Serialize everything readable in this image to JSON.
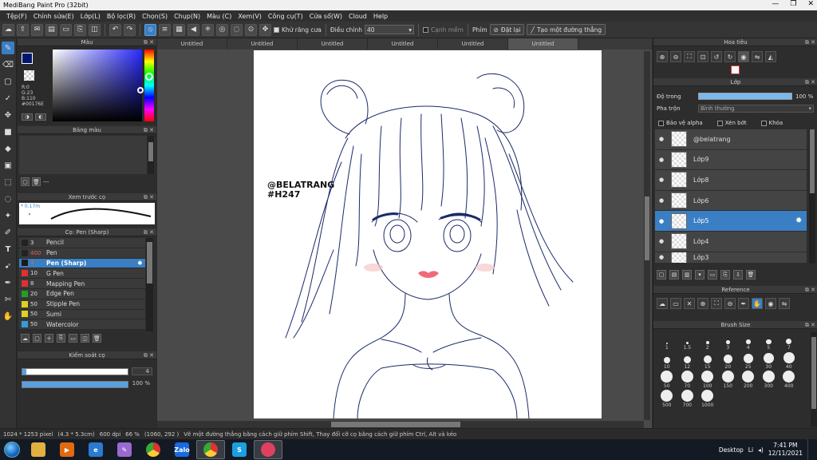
{
  "window": {
    "title": "MediBang Paint Pro (32bit)"
  },
  "menu": [
    "Tệp(F)",
    "Chỉnh sửa(E)",
    "Lớp(L)",
    "Bộ lọc(R)",
    "Chọn(S)",
    "Chụp(N)",
    "Màu (C)",
    "Xem(V)",
    "Công cụ(T)",
    "Cửa sổ(W)",
    "Cloud",
    "Help"
  ],
  "toolbar": {
    "antialias_label": "Khử răng cưa",
    "adjust_label": "Điều chỉnh",
    "adjust_value": "40",
    "soft_edge_label": "Cạnh mềm",
    "key_label": "Phím",
    "reset_label": "Đặt lại",
    "straight_line_label": "Tạo một đường thẳng"
  },
  "panels": {
    "color": "Màu",
    "palette": "Bảng màu",
    "preview": "Xem trước cọ",
    "brush": "Cọ: Pen (Sharp)",
    "control": "Kiểm soát cọ",
    "navigator": "Hoa tiêu",
    "layer": "Lớp",
    "reference": "Reference",
    "brush_size": "Brush Size"
  },
  "color": {
    "fg_hex": "#00176E",
    "rgb_r": "R:0",
    "rgb_g": "G:23",
    "rgb_b": "B:110",
    "rgb_hex": "#00176E"
  },
  "palette_text": "---",
  "preview_size": "0.17m",
  "brushes": [
    {
      "size": "3",
      "name": "Pencil",
      "color": "#222222"
    },
    {
      "size": "400",
      "name": "Pen",
      "color": "#222222"
    },
    {
      "size": "4",
      "name": "Pen (Sharp)",
      "color": "#1a1a1a",
      "selected": true
    },
    {
      "size": "10",
      "name": "G Pen",
      "color": "#e03030"
    },
    {
      "size": "8",
      "name": "Mapping Pen",
      "color": "#e03030"
    },
    {
      "size": "20",
      "name": "Edge Pen",
      "color": "#22a020"
    },
    {
      "size": "50",
      "name": "Stipple Pen",
      "color": "#e0d020"
    },
    {
      "size": "50",
      "name": "Sumi",
      "color": "#e0d020"
    },
    {
      "size": "50",
      "name": "Watercolor",
      "color": "#3a9ad8"
    }
  ],
  "brush_control": {
    "size_value": "4",
    "size_fraction": 0.04,
    "opacity_value": "100 %",
    "opacity_fraction": 1.0
  },
  "doc_tabs": [
    "Untitled",
    "Untitled",
    "Untitled",
    "Untitled",
    "Untitled",
    "Untitled"
  ],
  "watermark": {
    "line1": "@BELATRANG",
    "line2": "#H247"
  },
  "layer": {
    "opacity_label": "Độ trong",
    "opacity_value": "100 %",
    "blend_label": "Pha trộn",
    "blend_value": "Bình thường",
    "protect_alpha": "Bảo vệ alpha",
    "clipping": "Xén bớt",
    "lock": "Khóa",
    "layers": [
      {
        "name": "@belatrang",
        "selected": false
      },
      {
        "name": "Lớp9",
        "selected": false
      },
      {
        "name": "Lớp8",
        "selected": false
      },
      {
        "name": "Lớp6",
        "selected": false
      },
      {
        "name": "Lớp5",
        "selected": true
      },
      {
        "name": "Lớp4",
        "selected": false
      },
      {
        "name": "Lớp3",
        "selected": false
      }
    ]
  },
  "brush_sizes": [
    "1",
    "1.5",
    "2",
    "3",
    "4",
    "5",
    "7",
    "10",
    "12",
    "15",
    "20",
    "25",
    "30",
    "40",
    "50",
    "70",
    "100",
    "150",
    "200",
    "300",
    "400",
    "500",
    "700",
    "1000"
  ],
  "status": {
    "dimensions": "1024 * 1253 pixel",
    "physical": "(4.3 * 5.3cm)",
    "dpi": "600 dpi",
    "zoom": "66 %",
    "coords": "(1060, 292 )",
    "hint": "Vẽ một đường thẳng bằng cách giữ phím Shift, Thay đổi cỡ cọ bằng cách giữ phím Ctrl, Alt và kéo"
  },
  "taskbar": {
    "desktop_label": "Desktop",
    "lang": "Li",
    "time": "7:41 PM",
    "date": "12/11/2021",
    "apps": [
      {
        "name": "explorer",
        "label": "",
        "color": "#e0b040"
      },
      {
        "name": "media",
        "label": "▶",
        "color": "#e06a10"
      },
      {
        "name": "ie",
        "label": "e",
        "color": "#2a7ad0"
      },
      {
        "name": "paint",
        "label": "✎",
        "color": "#9a6ad0"
      },
      {
        "name": "chrome",
        "label": "",
        "color": "#d04030"
      },
      {
        "name": "zalo",
        "label": "Zalo",
        "color": "#1a6ae0"
      },
      {
        "name": "chrome2",
        "label": "",
        "color": "#d04030"
      },
      {
        "name": "skype",
        "label": "S",
        "color": "#1aa0e0"
      },
      {
        "name": "medibang",
        "label": "",
        "color": "#e04060"
      }
    ]
  }
}
